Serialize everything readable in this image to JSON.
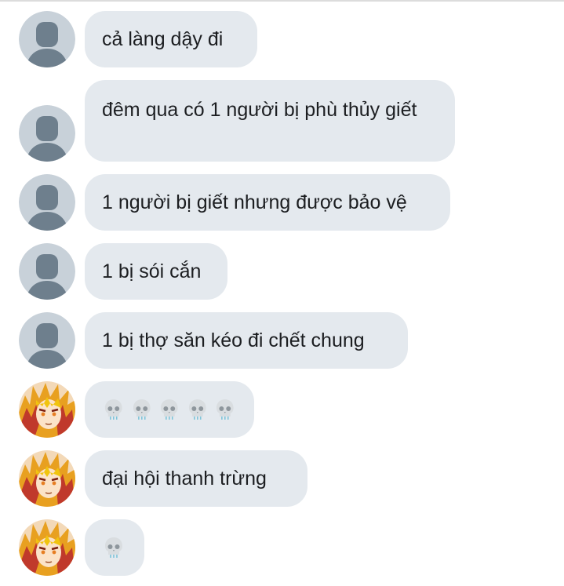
{
  "chat": {
    "messages": [
      {
        "sender": "default",
        "text": "cả làng dậy đi"
      },
      {
        "sender": "default",
        "text": "đêm qua có 1 người bị phù thủy giết"
      },
      {
        "sender": "default",
        "text": "1 người bị giết nhưng được bảo vệ"
      },
      {
        "sender": "default",
        "text": "1 bị sói cắn"
      },
      {
        "sender": "default",
        "text": "1 bị thợ săn kéo đi chết chung"
      },
      {
        "sender": "anime",
        "emoji": "skull",
        "emoji_count": 5
      },
      {
        "sender": "anime",
        "text": "đại hội thanh trừng"
      },
      {
        "sender": "anime",
        "emoji": "skull",
        "emoji_count": 1
      }
    ]
  },
  "colors": {
    "bubble_bg": "#e4e9ee",
    "text": "#1c1e21",
    "default_avatar_bg": "#c8d1d9",
    "default_avatar_fg": "#6e7f8d"
  },
  "icons": {
    "default_avatar": "default-user-icon",
    "anime_avatar": "anime-character-avatar",
    "emoji": "skull-emoji"
  }
}
